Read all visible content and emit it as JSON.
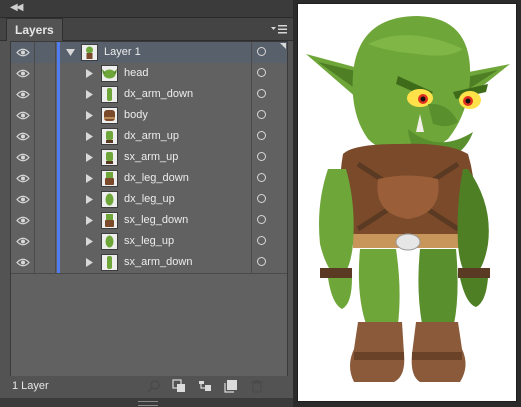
{
  "panel": {
    "tab_label": "Layers",
    "collapse_icon": "double-chevron-left-icon",
    "menu_icon": "panel-menu-icon",
    "footer_label": "1 Layer",
    "footer_icons": [
      "search-icon",
      "make-clipping-mask-icon",
      "create-sublayer-icon",
      "new-layer-icon",
      "trash-icon"
    ]
  },
  "layers": {
    "parent": {
      "name": "Layer 1"
    },
    "items": [
      {
        "name": "head"
      },
      {
        "name": "dx_arm_down"
      },
      {
        "name": "body"
      },
      {
        "name": "dx_arm_up"
      },
      {
        "name": "sx_arm_up"
      },
      {
        "name": "dx_leg_down"
      },
      {
        "name": "dx_leg_up"
      },
      {
        "name": "sx_leg_down"
      },
      {
        "name": "sx_leg_up"
      },
      {
        "name": "sx_arm_down"
      }
    ]
  },
  "colors": {
    "layer_color": "#4f7cf0",
    "panel_bg": "#535353",
    "row_bg": "#616161",
    "goblin_green": "#6fa63a"
  }
}
